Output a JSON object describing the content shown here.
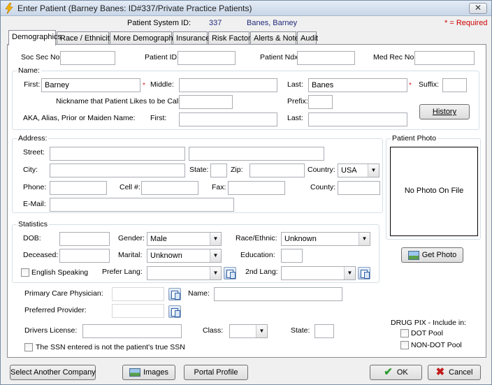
{
  "window": {
    "title": "Enter Patient (Barney Banes: ID#337/Private Practice Patients)",
    "close_label": "✕"
  },
  "header": {
    "system_id_label": "Patient System ID:",
    "system_id_value": "337",
    "patient_name": "Banes, Barney",
    "required_note": "* = Required"
  },
  "tabs": [
    {
      "label": "Demographics"
    },
    {
      "label": "Race / Ethnicity"
    },
    {
      "label": "More Demographics"
    },
    {
      "label": "Insurance"
    },
    {
      "label": "Risk Factors"
    },
    {
      "label": "Alerts & Notes"
    },
    {
      "label": "Audit"
    }
  ],
  "ids": {
    "ssn_label": "Soc Sec No:",
    "ssn_value": "",
    "patient_id_label": "Patient ID:",
    "patient_id_value": "",
    "patient_ndx_label": "Patient Ndx:",
    "patient_ndx_value": "",
    "med_rec_label": "Med Rec No:",
    "med_rec_value": ""
  },
  "name": {
    "group_title": "Name:",
    "first_label": "First:",
    "first_value": "Barney",
    "middle_label": "Middle:",
    "middle_value": "",
    "last_label": "Last:",
    "last_value": "Banes",
    "suffix_label": "Suffix:",
    "suffix_value": "",
    "nickname_label": "Nickname that Patient Likes to be Called:",
    "nickname_value": "",
    "prefix_label": "Prefix:",
    "prefix_value": "",
    "aka_label": "AKA, Alias, Prior or Maiden Name:",
    "aka_first_label": "First:",
    "aka_first_value": "",
    "aka_last_label": "Last:",
    "aka_last_value": "",
    "history_button": "History",
    "required_mark": "*"
  },
  "address": {
    "group_title": "Address:",
    "street_label": "Street:",
    "street1": "",
    "street2": "",
    "city_label": "City:",
    "city_value": "",
    "state_label": "State:",
    "state_value": "",
    "zip_label": "Zip:",
    "zip_value": "",
    "country_label": "Country:",
    "country_value": "USA",
    "phone_label": "Phone:",
    "phone_value": "",
    "cell_label": "Cell #:",
    "cell_value": "",
    "fax_label": "Fax:",
    "fax_value": "",
    "county_label": "County:",
    "county_value": "",
    "email_label": "E-Mail:",
    "email_value": ""
  },
  "photo": {
    "group_title": "Patient Photo",
    "placeholder": "No Photo On File",
    "get_photo_button": "Get Photo"
  },
  "statistics": {
    "group_title": "Statistics",
    "dob_label": "DOB:",
    "dob_value": "",
    "gender_label": "Gender:",
    "gender_value": "Male",
    "race_label": "Race/Ethnic:",
    "race_value": "Unknown",
    "deceased_label": "Deceased:",
    "deceased_value": "",
    "marital_label": "Marital:",
    "marital_value": "Unknown",
    "education_label": "Education:",
    "education_value": "",
    "english_label": "English Speaking",
    "prefer_lang_label": "Prefer Lang:",
    "prefer_lang_value": "",
    "second_lang_label": "2nd Lang:",
    "second_lang_value": ""
  },
  "providers": {
    "pcp_label": "Primary Care Physician:",
    "pcp_value": "",
    "pcp_name_label": "Name:",
    "pcp_name_value": "",
    "preferred_label": "Preferred Provider:",
    "preferred_value": ""
  },
  "license": {
    "label": "Drivers License:",
    "value": "",
    "class_label": "Class:",
    "class_value": "",
    "state_label": "State:",
    "state_value": ""
  },
  "ssn_note": "The SSN entered is not the patient's true SSN",
  "drug": {
    "title": "DRUG PIX - Include in:",
    "dot_label": "DOT Pool",
    "non_dot_label": "NON-DOT Pool"
  },
  "footer": {
    "select_company": "Select Another Company",
    "images": "Images",
    "portal": "Portal Profile",
    "ok": "OK",
    "cancel": "Cancel"
  }
}
